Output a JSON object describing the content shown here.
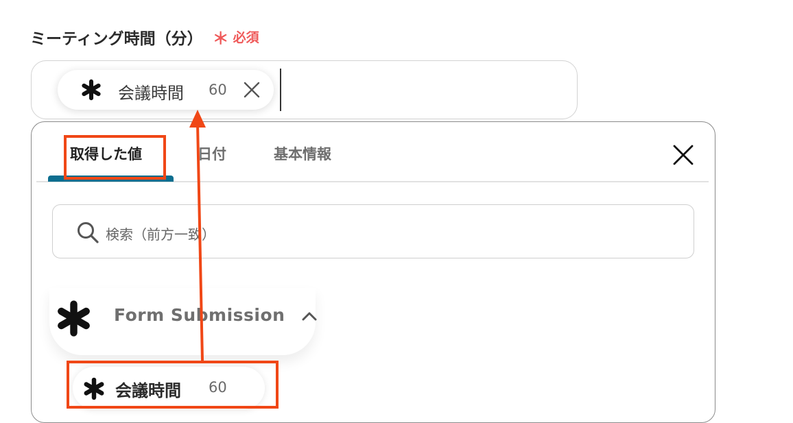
{
  "field": {
    "label": "ミーティング時間（分）",
    "required_mark": "＊",
    "required_text": "必須"
  },
  "selected_chip": {
    "label": "会議時間",
    "value": "60",
    "icon": "asterisk-icon",
    "remove_icon": "close-icon"
  },
  "panel": {
    "tabs": [
      {
        "label": "取得した値",
        "active": true
      },
      {
        "label": "日付",
        "active": false
      },
      {
        "label": "基本情報",
        "active": false
      }
    ],
    "close_icon": "close-icon",
    "search": {
      "placeholder": "検索（前方一致）",
      "icon": "search-icon"
    },
    "group": {
      "title": "Form Submission",
      "icon": "asterisk-icon",
      "chevron": "chevron-up-icon",
      "items": [
        {
          "label": "会議時間",
          "value": "60",
          "icon": "asterisk-icon"
        }
      ]
    }
  },
  "colors": {
    "required": "#ef5a5a",
    "tab_underline": "#0c6e8f",
    "annotation": "#f04716"
  }
}
